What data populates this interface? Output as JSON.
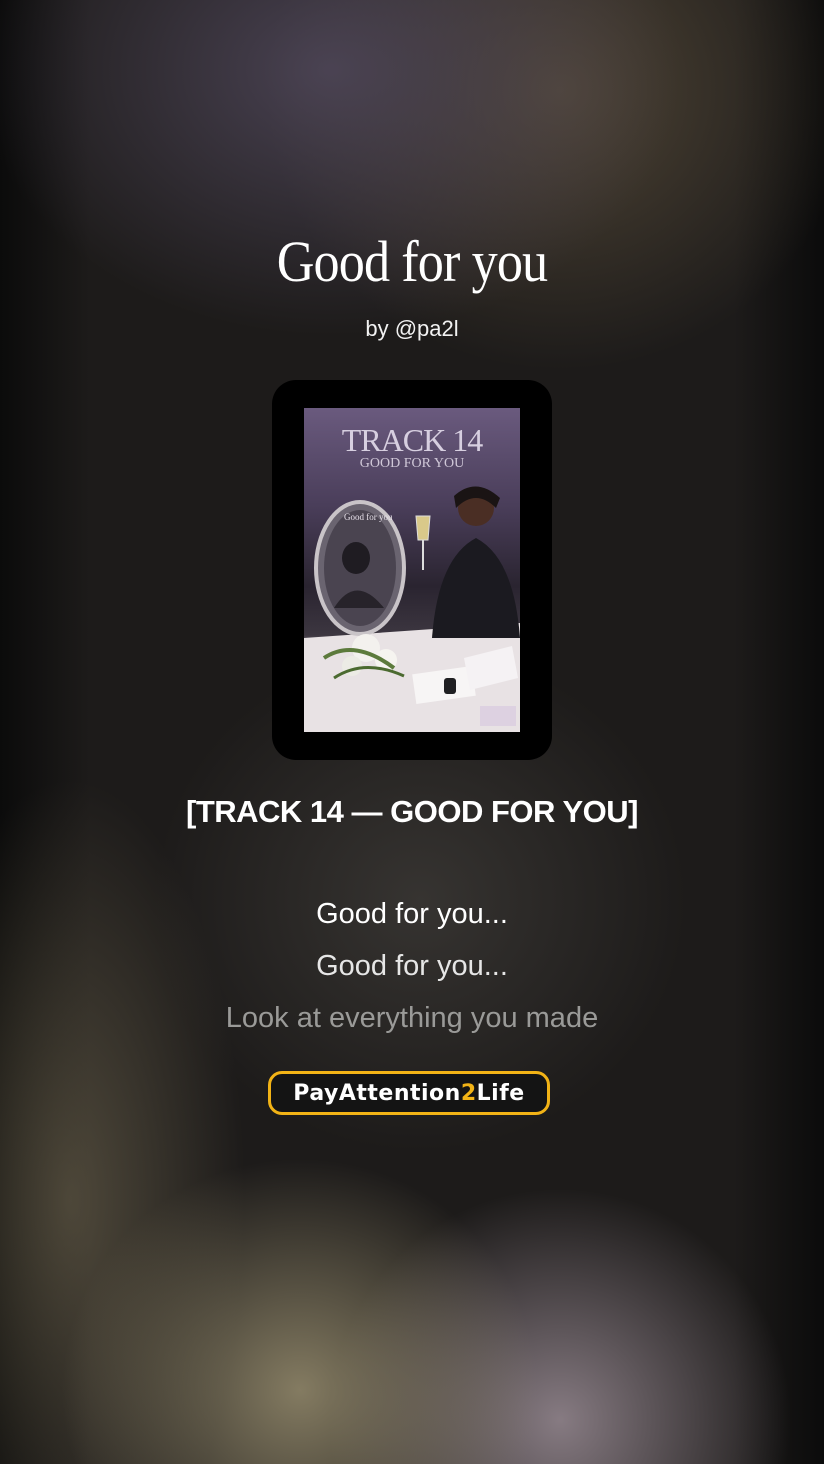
{
  "song": {
    "title": "Good for you",
    "byline": "by @pa2l"
  },
  "cover": {
    "title": "TRACK 14",
    "subtitle": "GOOD FOR YOU",
    "mirror_text": "Good for you"
  },
  "track_heading": "[TRACK 14 — GOOD FOR YOU]",
  "lyrics": [
    "Good for you...",
    "Good for you...",
    "Look at everything you made"
  ],
  "brand": {
    "text_before": "PayAttention",
    "text_accent": "2",
    "text_after": "Life",
    "accent_color": "#f2b316"
  }
}
